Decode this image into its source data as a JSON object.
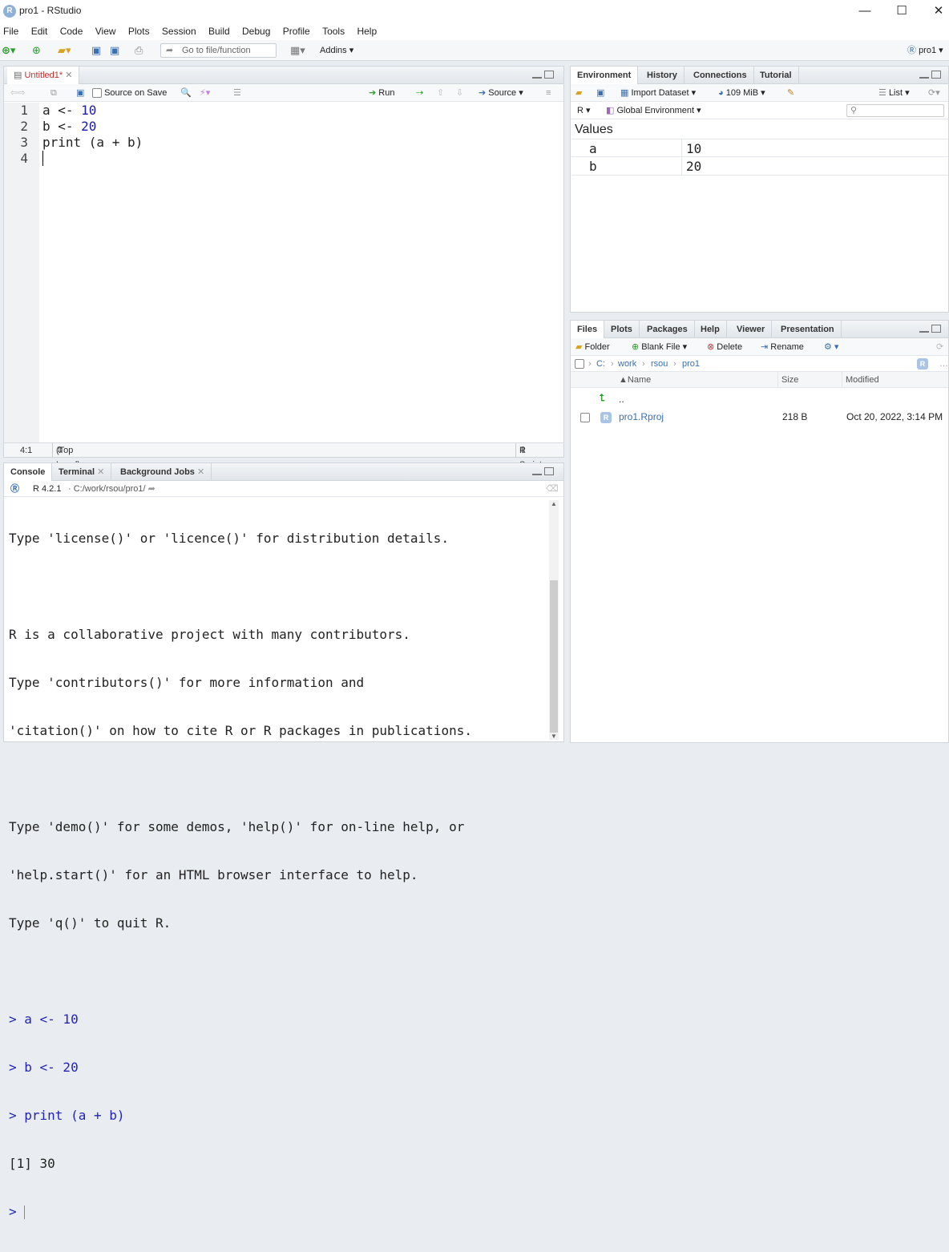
{
  "window": {
    "title": "pro1 - RStudio",
    "minimize": "—",
    "maximize": "☐",
    "close": "✕"
  },
  "menu": [
    "File",
    "Edit",
    "Code",
    "View",
    "Plots",
    "Session",
    "Build",
    "Debug",
    "Profile",
    "Tools",
    "Help"
  ],
  "toolbar": {
    "goto_placeholder": "Go to file/function",
    "addins": "Addins",
    "project": "pro1"
  },
  "editor": {
    "tab": "Untitled1*",
    "source_on_save": "Source on Save",
    "run": "Run",
    "source": "Source",
    "lines": [
      {
        "n": "1",
        "code": "a <- ",
        "num": "10"
      },
      {
        "n": "2",
        "code": "b <- ",
        "num": "20"
      },
      {
        "n": "3",
        "code": "print (a + b)",
        "num": ""
      },
      {
        "n": "4",
        "code": "",
        "num": ""
      }
    ],
    "status_pos": "4:1",
    "status_scope": "(Top Level)",
    "status_type": "R Script"
  },
  "console": {
    "tabs": [
      "Console",
      "Terminal",
      "Background Jobs"
    ],
    "r_version": "R 4.2.1",
    "path": "C:/work/rsou/pro1/",
    "output": [
      "Type 'license()' or 'licence()' for distribution details.",
      "",
      "R is a collaborative project with many contributors.",
      "Type 'contributors()' for more information and",
      "'citation()' on how to cite R or R packages in publications.",
      "",
      "Type 'demo()' for some demos, 'help()' for on-line help, or",
      "'help.start()' for an HTML browser interface to help.",
      "Type 'q()' to quit R.",
      ""
    ],
    "commands": [
      "> a <- 10",
      "> b <- 20",
      "> print (a + b)"
    ],
    "result": "[1] 30",
    "prompt": ">"
  },
  "environment": {
    "tabs": [
      "Environment",
      "History",
      "Connections",
      "Tutorial"
    ],
    "import_dataset": "Import Dataset",
    "memory": "109 MiB",
    "list_label": "List",
    "lang": "R",
    "scope": "Global Environment",
    "section": "Values",
    "rows": [
      {
        "name": "a",
        "value": "10"
      },
      {
        "name": "b",
        "value": "20"
      }
    ]
  },
  "files": {
    "tabs": [
      "Files",
      "Plots",
      "Packages",
      "Help",
      "Viewer",
      "Presentation"
    ],
    "folder": "Folder",
    "blank_file": "Blank File",
    "delete": "Delete",
    "rename": "Rename",
    "breadcrumb": [
      "C:",
      "work",
      "rsou",
      "pro1"
    ],
    "col_name": "Name",
    "col_size": "Size",
    "col_modified": "Modified",
    "parent": "..",
    "entries": [
      {
        "name": "pro1.Rproj",
        "size": "218 B",
        "modified": "Oct 20, 2022, 3:14 PM"
      }
    ]
  }
}
